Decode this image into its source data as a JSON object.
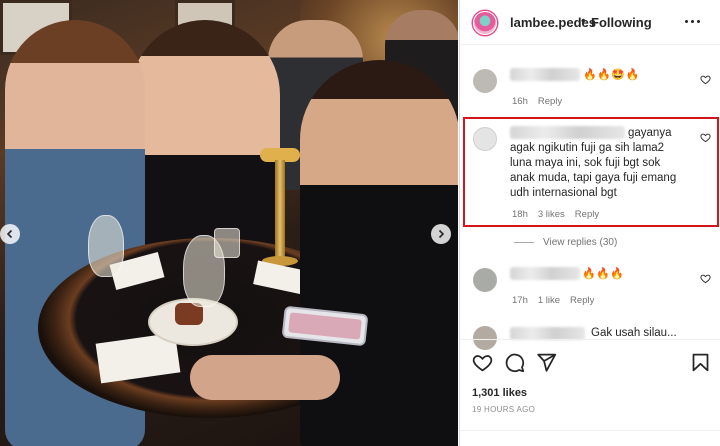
{
  "post": {
    "username": "lambee.pedes",
    "separator": "•",
    "follow_status": "Following",
    "likes": "1,301 likes",
    "posted_ago": "19 HOURS AGO"
  },
  "comments": [
    {
      "emojis": "🔥🔥🤩🔥",
      "time": "16h",
      "reply": "Reply"
    },
    {
      "text": "gayanya agak ngikutin fuji ga sih lama2 luna maya ini, sok fuji bgt sok anak muda, tapi gaya fuji emang udh internasional bgt",
      "time": "18h",
      "likes": "3 likes",
      "reply": "Reply",
      "view_replies": "View replies (30)"
    },
    {
      "emojis": "🔥🔥🔥",
      "time": "17h",
      "likes": "1 like",
      "reply": "Reply"
    },
    {
      "text": "Gak usah silau..."
    }
  ],
  "icons": {
    "like": "heart-icon",
    "comment": "comment-icon",
    "share": "send-icon",
    "save": "bookmark-icon",
    "more": "more-options-icon",
    "prev": "chevron-left-icon",
    "next": "chevron-right-icon"
  },
  "colors": {
    "highlight": "#d4161c",
    "text": "#262626",
    "muted": "#737373"
  }
}
